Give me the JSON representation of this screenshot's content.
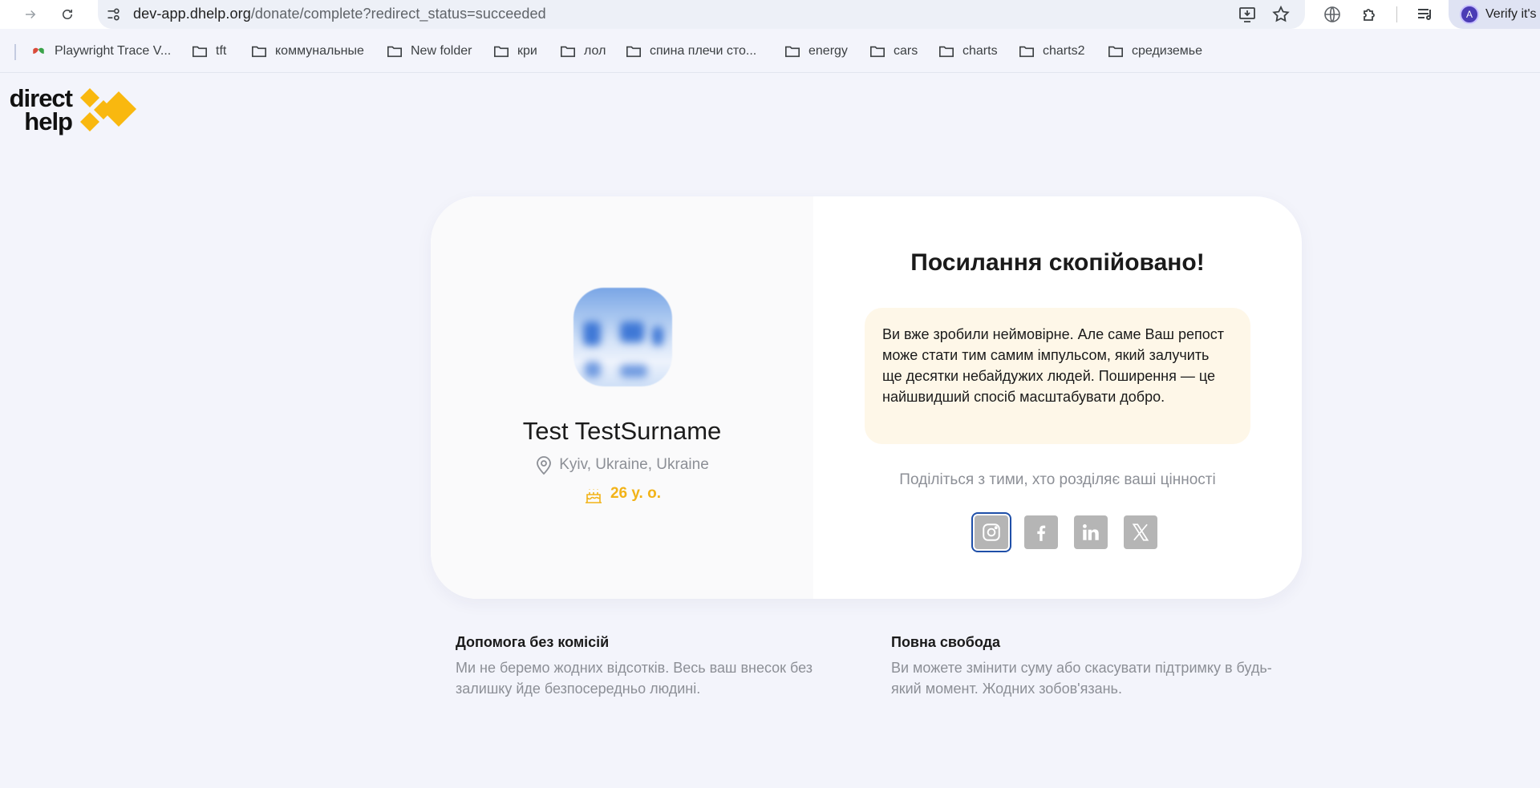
{
  "browser": {
    "url_host": "dev-app.dhelp.org",
    "url_path": "/donate/complete?redirect_status=succeeded",
    "profile_label": "Verify it's",
    "profile_initial": "A",
    "bookmarks": [
      {
        "label": "Playwright Trace V...",
        "icon": "playwright-icon"
      },
      {
        "label": "tft",
        "icon": "folder-icon"
      },
      {
        "label": "коммунальные",
        "icon": "folder-icon"
      },
      {
        "label": "New folder",
        "icon": "folder-icon"
      },
      {
        "label": "кри",
        "icon": "folder-icon"
      },
      {
        "label": "лол",
        "icon": "folder-icon"
      },
      {
        "label": "спина плечи сто...",
        "icon": "folder-icon"
      },
      {
        "label": "energy",
        "icon": "folder-icon"
      },
      {
        "label": "cars",
        "icon": "folder-icon"
      },
      {
        "label": "charts",
        "icon": "folder-icon"
      },
      {
        "label": "charts2",
        "icon": "folder-icon"
      },
      {
        "label": "средиземье",
        "icon": "folder-icon"
      }
    ]
  },
  "logo": {
    "line1": "direct",
    "line2": "help",
    "accent": "#f9b80f"
  },
  "profile_card": {
    "name": "Test TestSurname",
    "location": "Kyiv, Ukraine, Ukraine",
    "age": "26 y. o."
  },
  "share": {
    "title": "Посилання скопійовано!",
    "note": "Ви вже зробили неймовірне. Але саме Ваш репост може стати тим самим імпульсом, який залучить ще десятки небайдужих людей. Поширення — це найшвидший спосіб масштабувати добро.",
    "hint": "Поділіться з тими, хто розділяє ваші цінності",
    "networks": [
      {
        "id": "instagram",
        "icon": "instagram-icon",
        "selected": true
      },
      {
        "id": "facebook",
        "icon": "facebook-icon",
        "selected": false
      },
      {
        "id": "linkedin",
        "icon": "linkedin-icon",
        "selected": false
      },
      {
        "id": "x",
        "icon": "x-icon",
        "selected": false
      }
    ]
  },
  "features": [
    {
      "title": "Допомога без комісій",
      "text": "Ми не беремо жодних відсотків. Весь ваш внесок без залишку йде безпосередньо людині."
    },
    {
      "title": "Повна свобода",
      "text": "Ви можете змінити суму або скасувати підтримку в будь-який момент. Жодних зобов'язань."
    }
  ],
  "colors": {
    "page_bg": "#f3f4fb",
    "accent_yellow": "#f2b318",
    "note_bg": "#fef7e8",
    "focus_ring": "#1f4fa8"
  }
}
